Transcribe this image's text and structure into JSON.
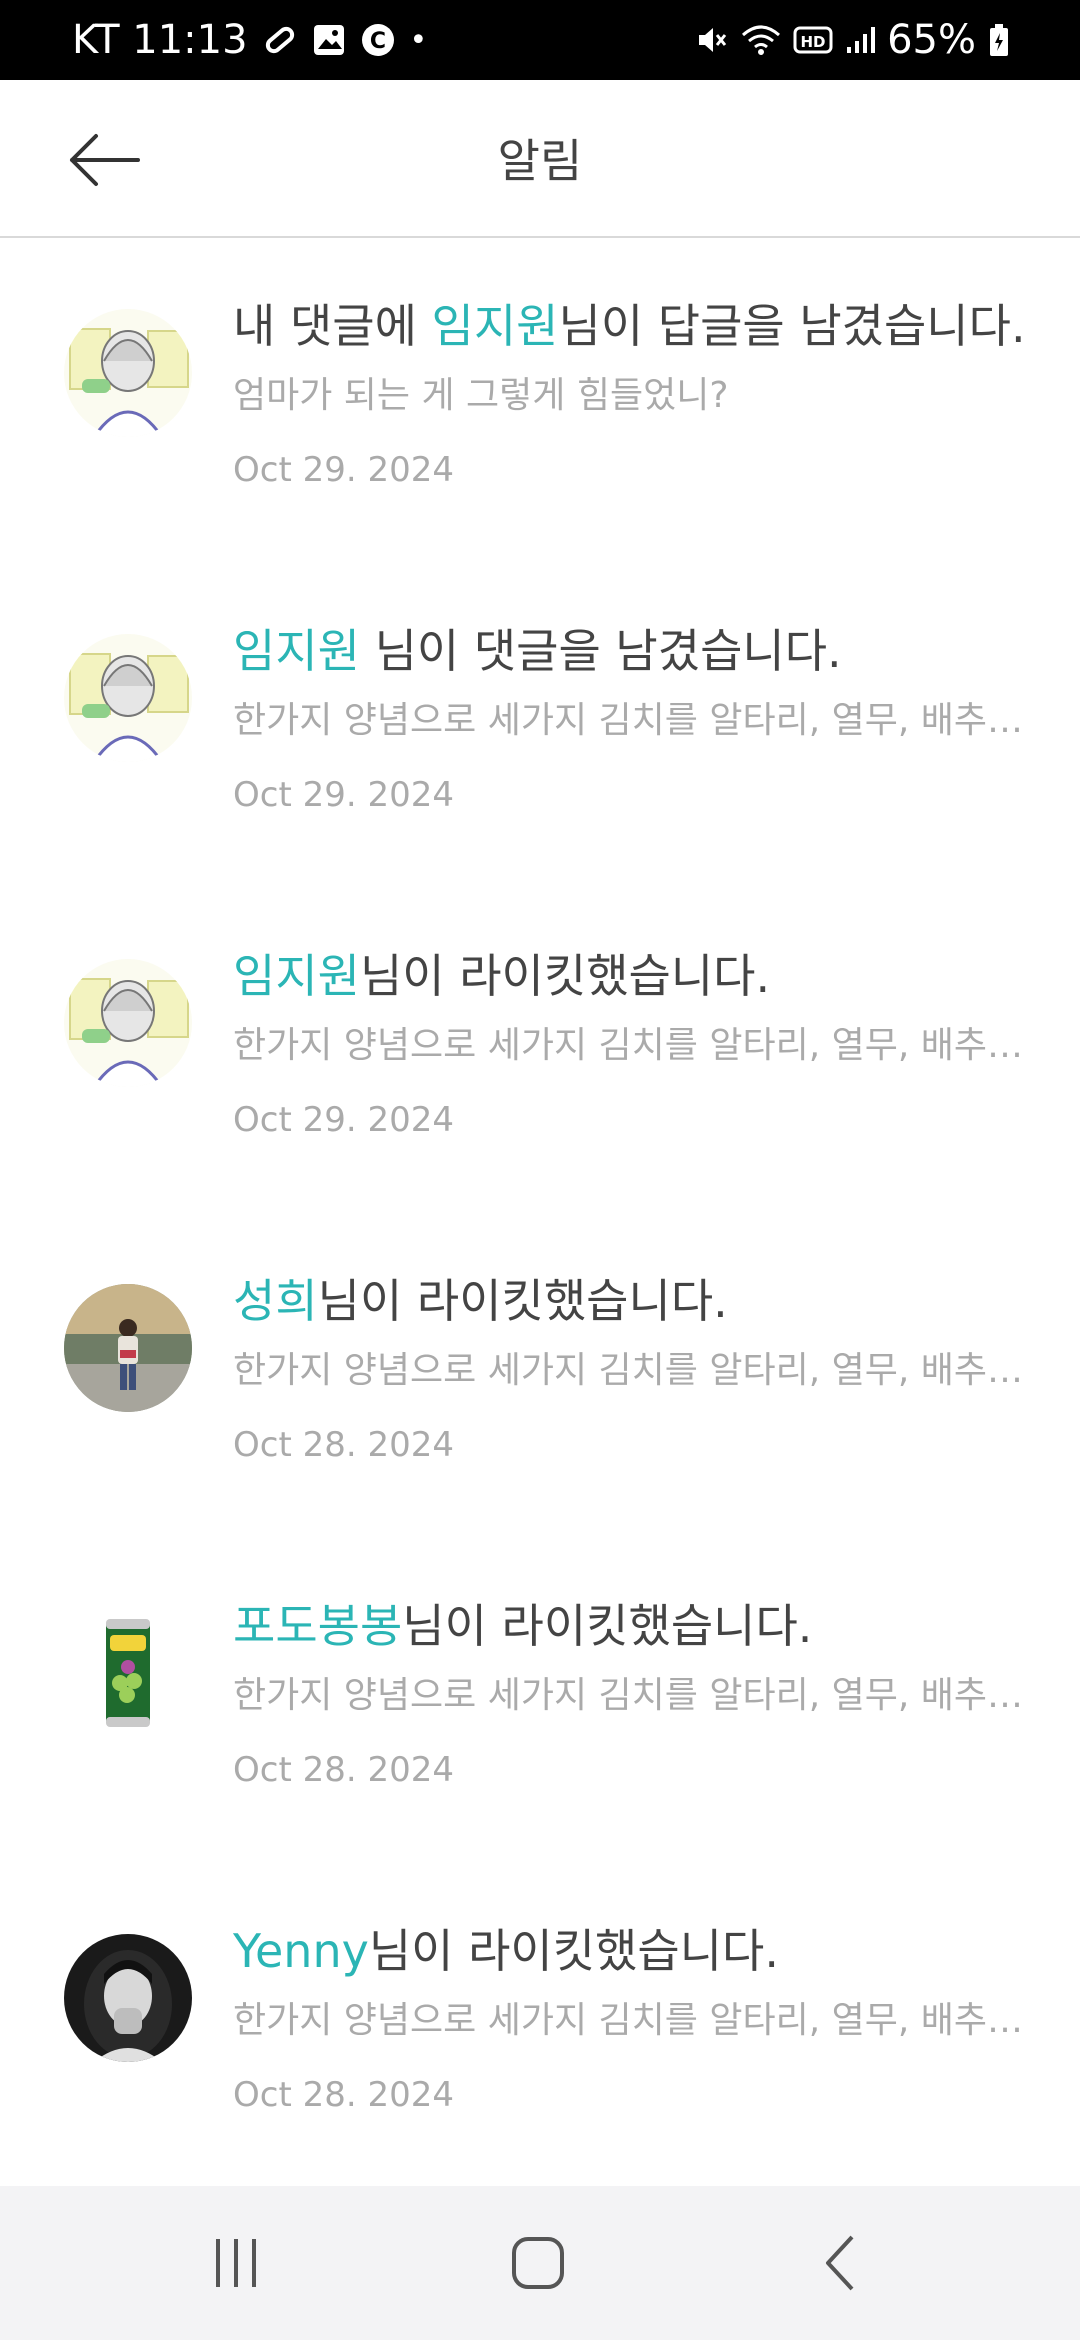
{
  "status_bar": {
    "carrier_time": "KT 11:13",
    "dot": "•",
    "battery": "65%"
  },
  "header": {
    "title": "알림"
  },
  "notifications": [
    {
      "prefix": "내 댓글에 ",
      "name": "임지원",
      "suffix": "님이 답글을 남겼습니다.",
      "preview": "엄마가 되는 게 그렇게 힘들었니?",
      "date": "Oct 29. 2024",
      "avatar": "sketch-portrait"
    },
    {
      "prefix": "",
      "name": "임지원",
      "suffix": " 님이 댓글을 남겼습니다.",
      "preview": "한가지 양념으로 세가지 김치를 알타리, 열무, 배추김치",
      "date": "Oct 29. 2024",
      "avatar": "sketch-portrait"
    },
    {
      "prefix": "",
      "name": "임지원",
      "suffix": "님이 라이킷했습니다.",
      "preview": "한가지 양념으로 세가지 김치를 알타리, 열무, 배추김치",
      "date": "Oct 29. 2024",
      "avatar": "sketch-portrait"
    },
    {
      "prefix": "",
      "name": "성희",
      "suffix": "님이 라이킷했습니다.",
      "preview": "한가지 양념으로 세가지 김치를 알타리, 열무, 배추김치",
      "date": "Oct 28. 2024",
      "avatar": "outdoor-photo"
    },
    {
      "prefix": "",
      "name": "포도봉봉",
      "suffix": "님이 라이킷했습니다.",
      "preview": "한가지 양념으로 세가지 김치를 알타리, 열무, 배추김치",
      "date": "Oct 28. 2024",
      "avatar": "grape-can"
    },
    {
      "prefix": "",
      "name": "Yenny",
      "suffix": "님이 라이킷했습니다.",
      "preview": "한가지 양념으로 세가지 김치를 알타리, 열무, 배추김치",
      "date": "Oct 28. 2024",
      "avatar": "bw-portrait"
    }
  ],
  "colors": {
    "accent": "#2bb5b5",
    "text": "#444444",
    "muted": "#aaaaaa"
  }
}
